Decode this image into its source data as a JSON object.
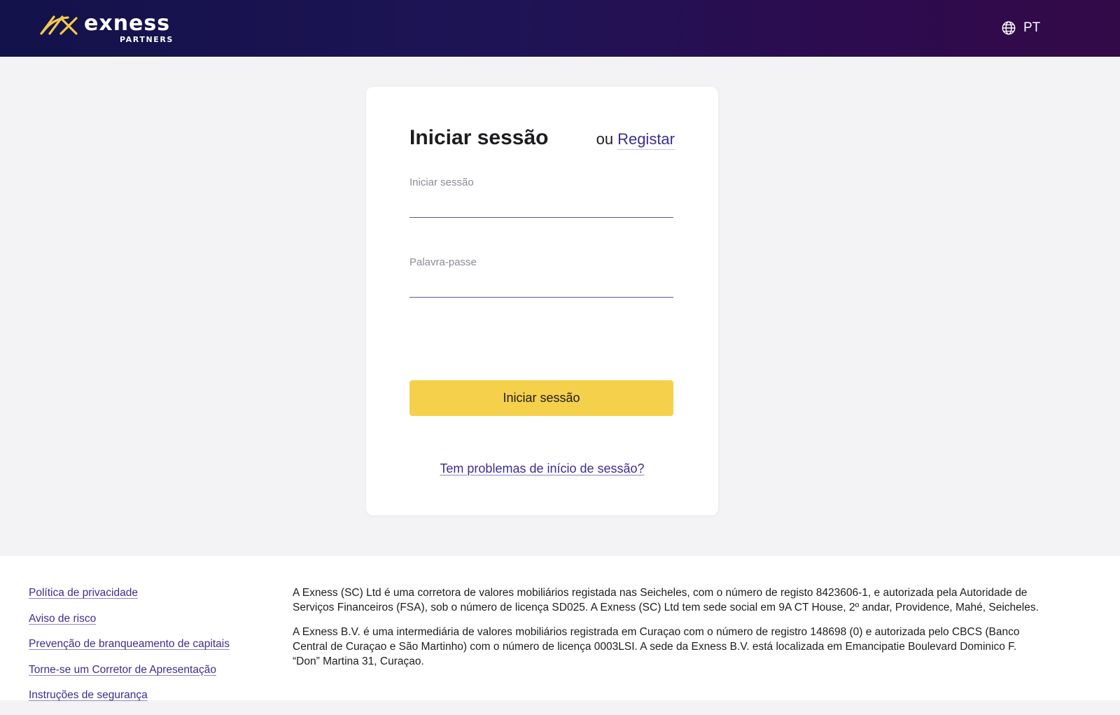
{
  "header": {
    "brand": "exness",
    "brand_sub": "PARTNERS",
    "language": "PT",
    "accent_color": "#f5d04a"
  },
  "login": {
    "title": "Iniciar sessão",
    "or_text": "ou",
    "register_link": "Registar",
    "username_label": "Iniciar sessão",
    "username_value": "",
    "password_label": "Palavra-passe",
    "password_value": "",
    "submit_label": "Iniciar sessão",
    "trouble_link": "Tem problemas de início de sessão?"
  },
  "footer": {
    "links": [
      "Política de privacidade",
      "Aviso de risco",
      "Prevenção de branqueamento de capitais",
      "Torne-se um Corretor de Apresentação",
      "Instruções de segurança"
    ],
    "legal": [
      "A Exness (SC) Ltd é uma corretora de valores mobiliários registada nas Seicheles, com o número de registo 8423606-1, e autorizada pela Autoridade de Serviços Financeiros (FSA), sob o número de licença SD025. A Exness (SC) Ltd tem sede social em 9A CT House, 2º andar, Providence, Mahé, Seicheles.",
      "A Exness B.V. é uma intermediária de valores mobiliários registrada em Curaçao com o número de registro 148698 (0) e autorizada pelo CBCS (Banco Central de Curaçao e São Martinho) com o número de licença 0003LSI. A sede da Exness B.V. está localizada em Emancipatie Boulevard Dominico F. “Don” Martina 31, Curaçao."
    ]
  }
}
